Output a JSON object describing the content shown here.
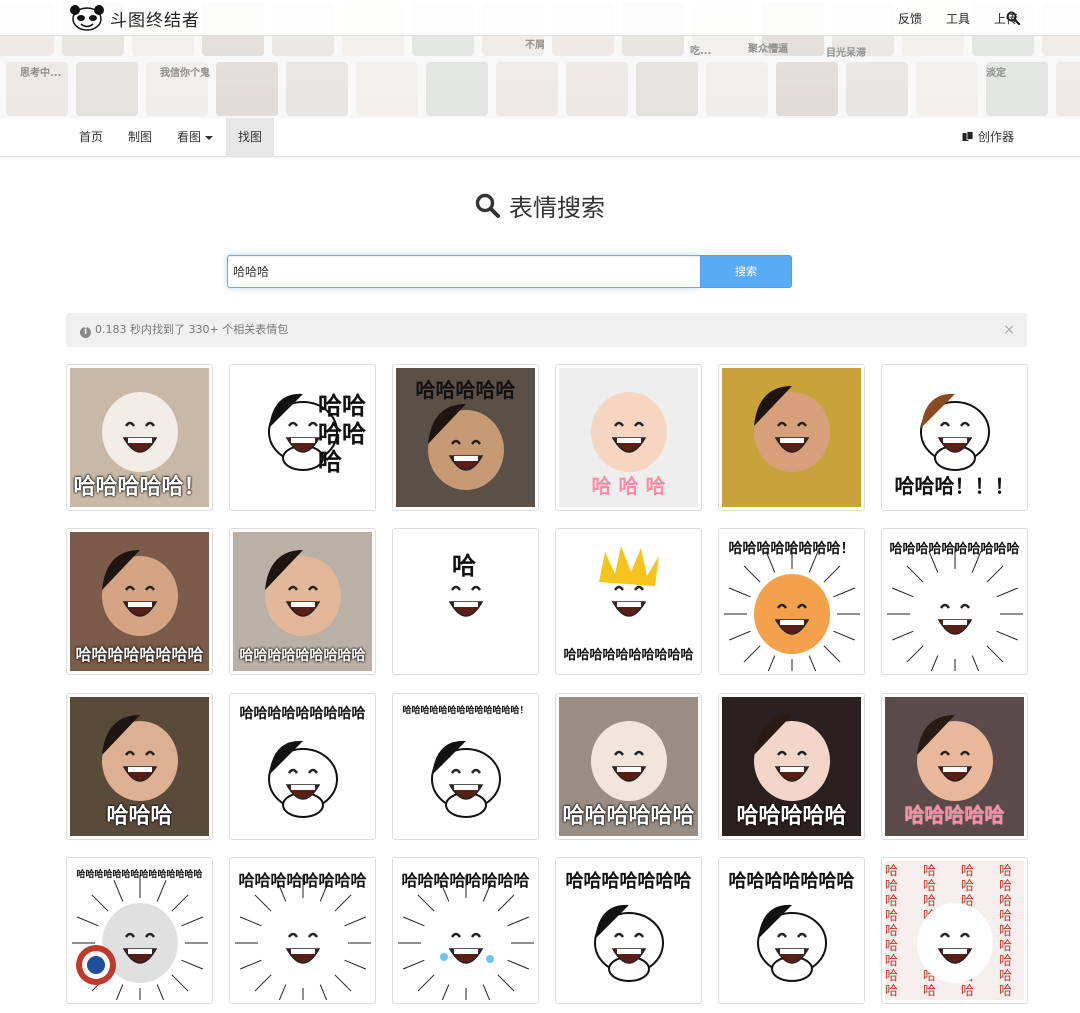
{
  "site": {
    "logo_text": "斗图终结者",
    "top_links": [
      "反馈",
      "工具",
      "上传"
    ]
  },
  "nav": {
    "items": [
      "首页",
      "制图",
      "看图",
      "找图"
    ],
    "active": "找图",
    "creator_label": "创作器"
  },
  "search": {
    "title": "表情搜索",
    "query": "哈哈哈",
    "button_label": "搜索"
  },
  "result_info": {
    "text": "0.183 秒内找到了 330+ 个相关表情包",
    "close": "×"
  },
  "header_collage_captions": [
    "不屑",
    "聚众懵逼",
    "目光呆滞",
    "我信你个鬼",
    "淡定",
    "思考中...",
    "吃..."
  ],
  "results": [
    {
      "caption": "哈哈哈哈哈！",
      "style": "bottom-white",
      "bg": "#c9b8a6",
      "kind": "cat"
    },
    {
      "caption": "哈哈\n哈哈\n哈",
      "style": "side-black",
      "bg": "#ffffff",
      "kind": "panda"
    },
    {
      "caption": "哈哈哈哈哈",
      "style": "top-black",
      "bg": "#5a5048",
      "kind": "boy"
    },
    {
      "caption": "哈 哈 哈",
      "style": "bottom-pink",
      "bg": "#eeeeee",
      "kind": "baby"
    },
    {
      "caption": "",
      "style": "none",
      "bg": "#c9a23a",
      "kind": "man"
    },
    {
      "caption": "哈哈哈！！！",
      "style": "bottom-black",
      "bg": "#ffffff",
      "kind": "wig"
    },
    {
      "caption": "哈哈哈哈哈哈哈哈",
      "style": "bottom-white",
      "bg": "#7a5a48",
      "kind": "laugh-man"
    },
    {
      "caption": "哈哈哈哈哈哈哈哈哈",
      "style": "bottom-white",
      "bg": "#b9b1a6",
      "kind": "actor"
    },
    {
      "caption": "哈",
      "style": "scatter",
      "bg": "#ffffff",
      "kind": "bear"
    },
    {
      "caption": "哈哈哈哈哈哈哈哈哈哈",
      "style": "bottom-black",
      "bg": "#ffffff",
      "kind": "spiky"
    },
    {
      "caption": "哈哈哈哈哈哈哈哈！",
      "style": "top-black",
      "bg": "#ffffff",
      "kind": "orange"
    },
    {
      "caption": "哈哈哈哈哈哈哈哈哈哈",
      "style": "top-black",
      "bg": "#ffffff",
      "kind": "ultraman"
    },
    {
      "caption": "哈哈哈",
      "style": "bottom-white",
      "bg": "#5a4a3a",
      "kind": "guy"
    },
    {
      "caption": "哈哈哈哈哈哈哈哈哈",
      "style": "top-black",
      "bg": "#ffffff",
      "kind": "girl-cartoon"
    },
    {
      "caption": "哈哈哈哈哈哈哈哈哈哈哈哈哈！",
      "style": "top-black",
      "bg": "#ffffff",
      "kind": "panda-small"
    },
    {
      "caption": "哈哈哈哈哈哈",
      "style": "bottom-white",
      "bg": "#9a8e84",
      "kind": "cat2"
    },
    {
      "caption": "哈哈哈哈哈",
      "style": "bottom-white",
      "bg": "#2a2020",
      "kind": "girl"
    },
    {
      "caption": "哈哈哈哈哈",
      "style": "bottom-pink",
      "bg": "#5a4a4a",
      "kind": "woman"
    },
    {
      "caption": "哈哈哈哈哈哈哈哈哈哈哈哈哈哈",
      "style": "top-black",
      "bg": "#ffffff",
      "kind": "captain"
    },
    {
      "caption": "哈哈哈哈哈哈哈哈",
      "style": "top-black",
      "bg": "#ffffff",
      "kind": "rage"
    },
    {
      "caption": "哈哈哈哈哈哈哈哈",
      "style": "top-black",
      "bg": "#ffffff",
      "kind": "rage-cry"
    },
    {
      "caption": "哈哈哈哈哈哈哈",
      "style": "top-black",
      "bg": "#ffffff",
      "kind": "panda-stick"
    },
    {
      "caption": "哈哈哈哈哈哈哈",
      "style": "top-black",
      "bg": "#ffffff",
      "kind": "panda2"
    },
    {
      "caption": "哈哈哈哈哈哈哈哈",
      "style": "pattern",
      "bg": "#f7eeee",
      "kind": "anime"
    }
  ]
}
